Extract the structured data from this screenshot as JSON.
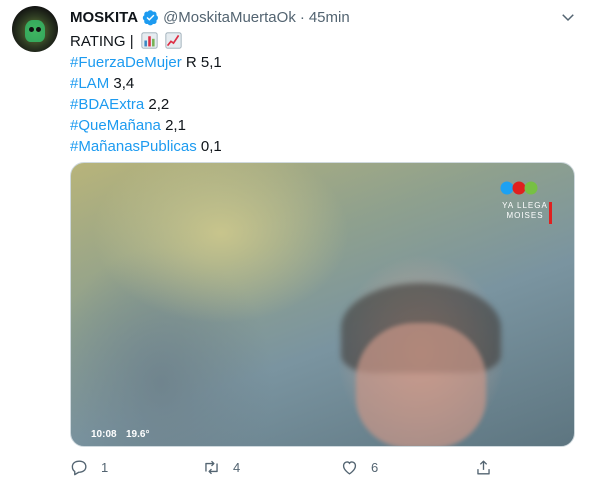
{
  "tweet": {
    "display_name": "MOSKITA",
    "handle": "@MoskitaMuertaOk",
    "separator": "·",
    "time": "45min",
    "lines": [
      {
        "tag": "",
        "prefix": "RATING |",
        "value": "",
        "emojis": [
          "bar-chart-emoji",
          "chart-increasing-emoji"
        ]
      },
      {
        "tag": "#FuerzaDeMujer",
        "value": "R 5,1"
      },
      {
        "tag": "#LAM",
        "value": "3,4"
      },
      {
        "tag": "#BDAExtra",
        "value": "2,2"
      },
      {
        "tag": "#QueMañana",
        "value": "2,1"
      },
      {
        "tag": "#MañanasPublicas",
        "value": "0,1"
      }
    ],
    "media": {
      "overlay_line1": "YA LLEGA",
      "overlay_line2": "MOISES",
      "clock": "10:08",
      "temperature": "19.6°"
    },
    "actions": {
      "reply_count": "1",
      "retweet_count": "4",
      "like_count": "6"
    }
  },
  "colors": {
    "link": "#1d9bf0",
    "secondary_text": "#536471",
    "primary_text": "#0f1419",
    "verified": "#1d9bf0"
  }
}
